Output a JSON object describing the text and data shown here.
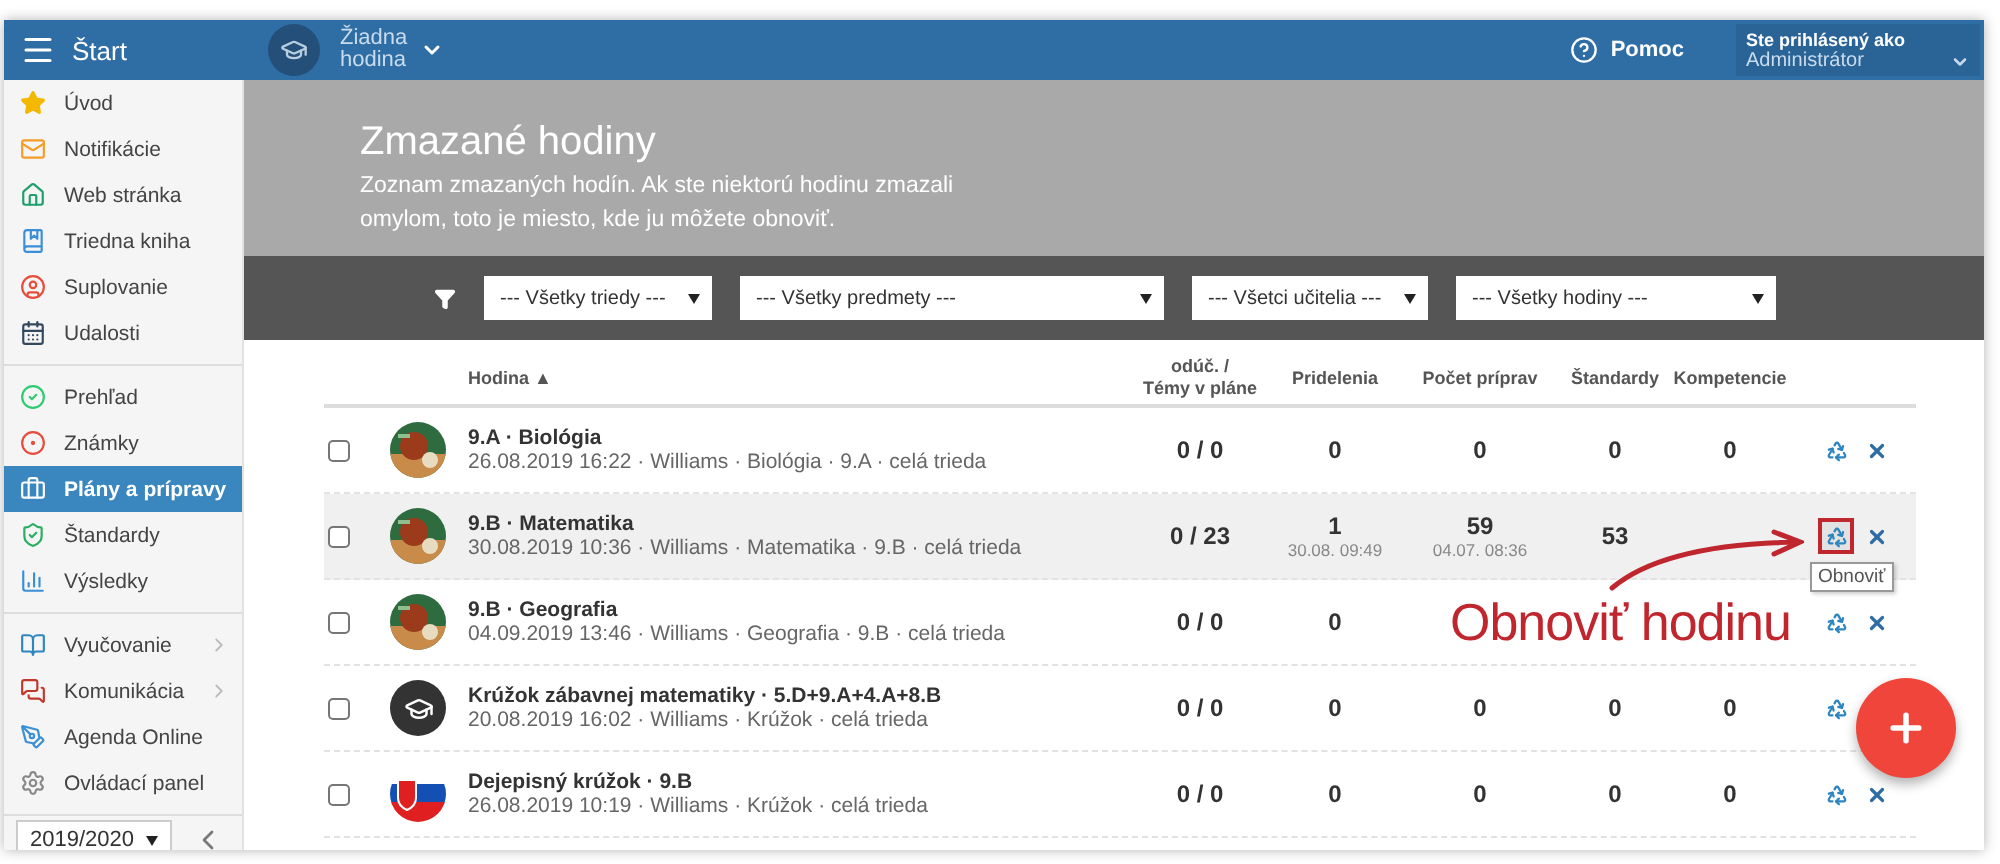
{
  "topbar": {
    "menu_label": "Štart",
    "course": "Žiadna hodina",
    "help": "Pomoc",
    "user_caption": "Ste prihlásený ako",
    "user_name": "Administrátor"
  },
  "sidebar": {
    "groups": [
      {
        "items": [
          {
            "label": "Úvod",
            "selected": false
          },
          {
            "label": "Notifikácie",
            "selected": false
          },
          {
            "label": "Web stránka",
            "selected": false
          },
          {
            "label": "Triedna kniha",
            "selected": false
          },
          {
            "label": "Suplovanie",
            "selected": false
          },
          {
            "label": "Udalosti",
            "selected": false
          }
        ]
      },
      {
        "items": [
          {
            "label": "Prehľad",
            "selected": false
          },
          {
            "label": "Známky",
            "selected": false
          },
          {
            "label": "Plány a prípravy",
            "selected": true
          },
          {
            "label": "Štandardy",
            "selected": false
          },
          {
            "label": "Výsledky",
            "selected": false
          }
        ]
      },
      {
        "items": [
          {
            "label": "Vyučovanie",
            "selected": false,
            "submenu": true
          },
          {
            "label": "Komunikácia",
            "selected": false,
            "submenu": true
          },
          {
            "label": "Agenda Online",
            "selected": false,
            "submenu": false
          },
          {
            "label": "Ovládací panel",
            "selected": false,
            "submenu": false
          }
        ]
      }
    ],
    "year": "2019/2020"
  },
  "header": {
    "title": "Zmazané hodiny",
    "description": "Zoznam zmazaných hodín. Ak ste niektorú hodinu zmazali omylom, toto je miesto, kde ju môžete obnoviť."
  },
  "filters": [
    "--- Všetky triedy ---",
    "--- Všetky predmety ---",
    "--- Všetci učitelia ---",
    "--- Všetky hodiny ---"
  ],
  "table": {
    "columns": [
      "Hodina ▲",
      "odúč. /\nTémy v pláne",
      "Pridelenia",
      "Počet príprav",
      "Štandardy",
      "Kompetencie"
    ],
    "rows": [
      {
        "checked": false,
        "highlighted": false,
        "avatar": {
          "kind": "picture"
        },
        "actions": [
          {
            "kind": "restore",
            "marked": false
          },
          {
            "kind": "delete"
          }
        ],
        "cells": [
          {
            "title": "9.A · Biológia",
            "meta": "26.08.2019 16:22 · Williams · Biológia · 9.A · celá trieda"
          },
          {
            "value": "0 / 0"
          },
          {
            "value": "0"
          },
          {
            "value": "0"
          },
          {
            "value": "0"
          },
          {
            "value": "0"
          }
        ]
      },
      {
        "checked": false,
        "highlighted": true,
        "avatar": {
          "kind": "picture"
        },
        "actions": [
          {
            "kind": "restore",
            "marked": true,
            "tooltip": "Obnoviť"
          },
          {
            "kind": "delete"
          }
        ],
        "cells": [
          {
            "title": "9.B · Matematika",
            "meta": "30.08.2019 10:36 · Williams · Matematika · 9.B · celá trieda"
          },
          {
            "value": "0 / 23"
          },
          {
            "value": "1",
            "sub": "30.08. 09:49"
          },
          {
            "value": "59",
            "sub": "04.07. 08:36"
          },
          {
            "value": "53"
          }
        ]
      },
      {
        "checked": false,
        "highlighted": false,
        "avatar": {
          "kind": "picture"
        },
        "actions": [
          {
            "kind": "restore",
            "marked": false
          },
          {
            "kind": "delete"
          }
        ],
        "cells": [
          {
            "title": "9.B · Geografia",
            "meta": "04.09.2019 13:46 · Williams · Geografia · 9.B · celá trieda"
          },
          {
            "value": "0 / 0"
          },
          {
            "value": "0"
          }
        ]
      },
      {
        "checked": false,
        "highlighted": false,
        "avatar": {
          "kind": "cap"
        },
        "actions": [
          {
            "kind": "restore",
            "marked": false
          }
        ],
        "cells": [
          {
            "title": "Krúžok zábavnej matematiky · 5.D+9.A+4.A+8.B",
            "meta": "20.08.2019 16:02 · Williams · Krúžok · celá trieda"
          },
          {
            "value": "0 / 0"
          },
          {
            "value": "0"
          },
          {
            "value": "0"
          },
          {
            "value": "0"
          },
          {
            "value": "0"
          }
        ]
      },
      {
        "checked": false,
        "highlighted": false,
        "avatar": {
          "kind": "flag"
        },
        "actions": [
          {
            "kind": "restore",
            "marked": false
          },
          {
            "kind": "delete"
          }
        ],
        "cells": [
          {
            "title": "Dejepisný krúžok · 9.B",
            "meta": "26.08.2019 10:19 · Williams · Krúžok · celá trieda"
          },
          {
            "value": "0 / 0"
          },
          {
            "value": "0"
          },
          {
            "value": "0"
          },
          {
            "value": "0"
          },
          {
            "value": "0"
          }
        ]
      }
    ]
  },
  "annotation": {
    "text": "Obnoviť hodinu"
  }
}
